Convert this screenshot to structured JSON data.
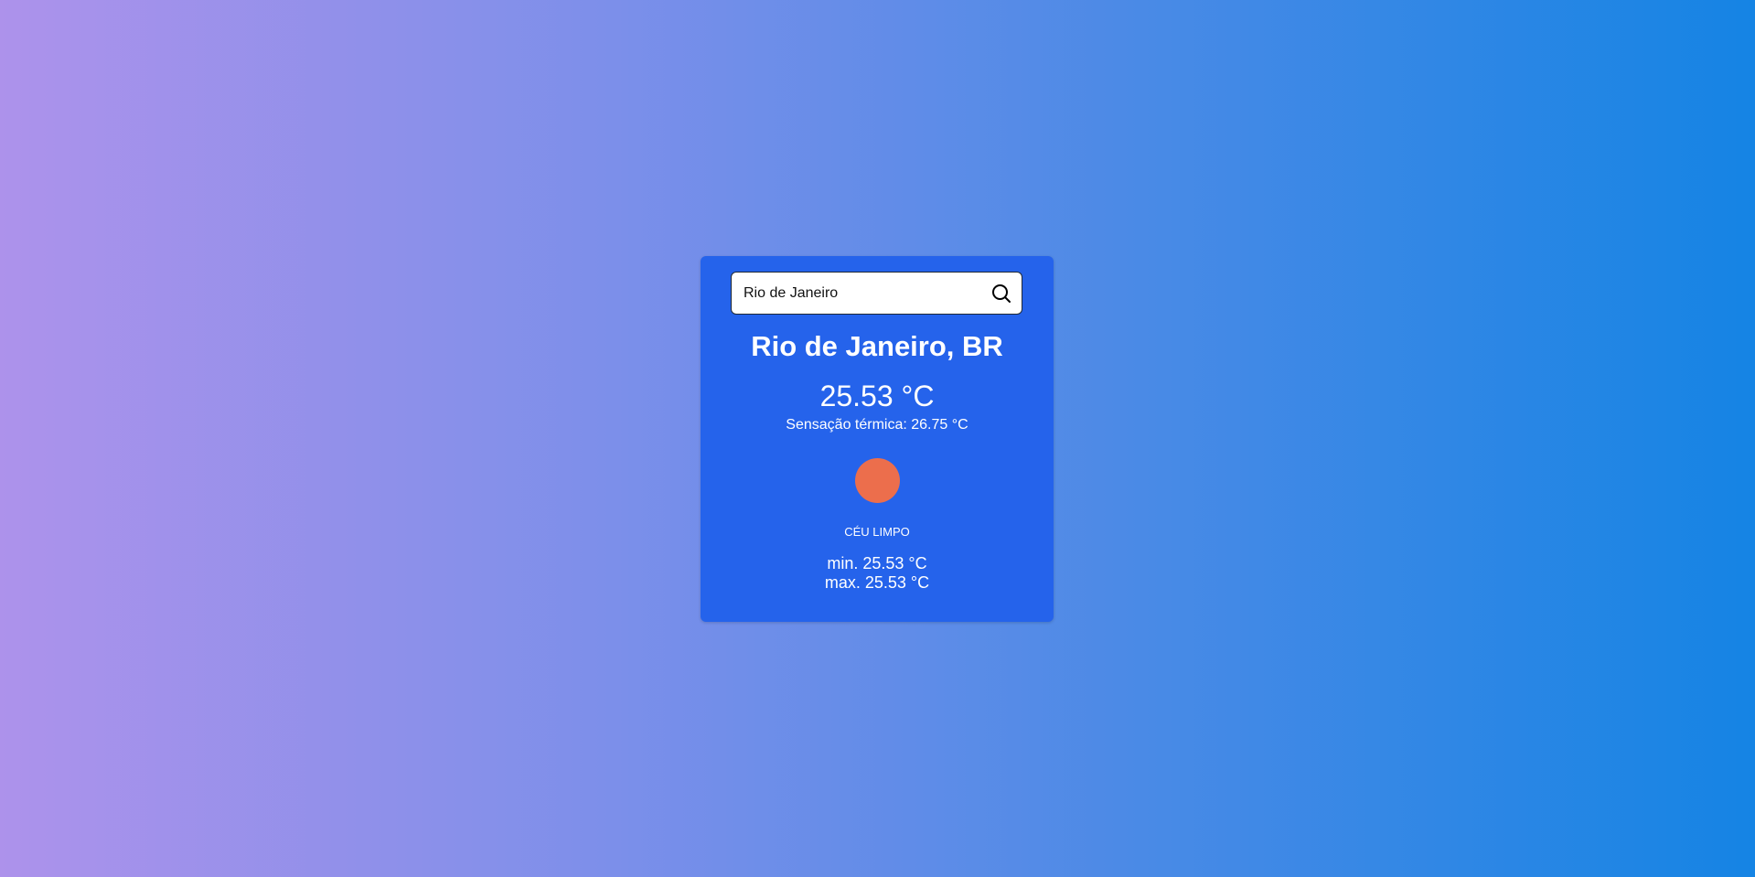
{
  "search": {
    "value": "Rio de Janeiro",
    "placeholder": "",
    "icon": "search-icon"
  },
  "weather": {
    "city": "Rio de Janeiro, BR",
    "temperature": "25.53 °C",
    "feels_like": "Sensação térmica: 26.75 °C",
    "icon": "clear-sky-icon",
    "description": "Céu limpo",
    "min": "min. 25.53 °C",
    "max": "max. 25.53 °C"
  },
  "colors": {
    "card": "#2563eb",
    "icon": "#ec6e4c",
    "gradient_start": "#ad92eb",
    "gradient_end": "#1584e4"
  }
}
